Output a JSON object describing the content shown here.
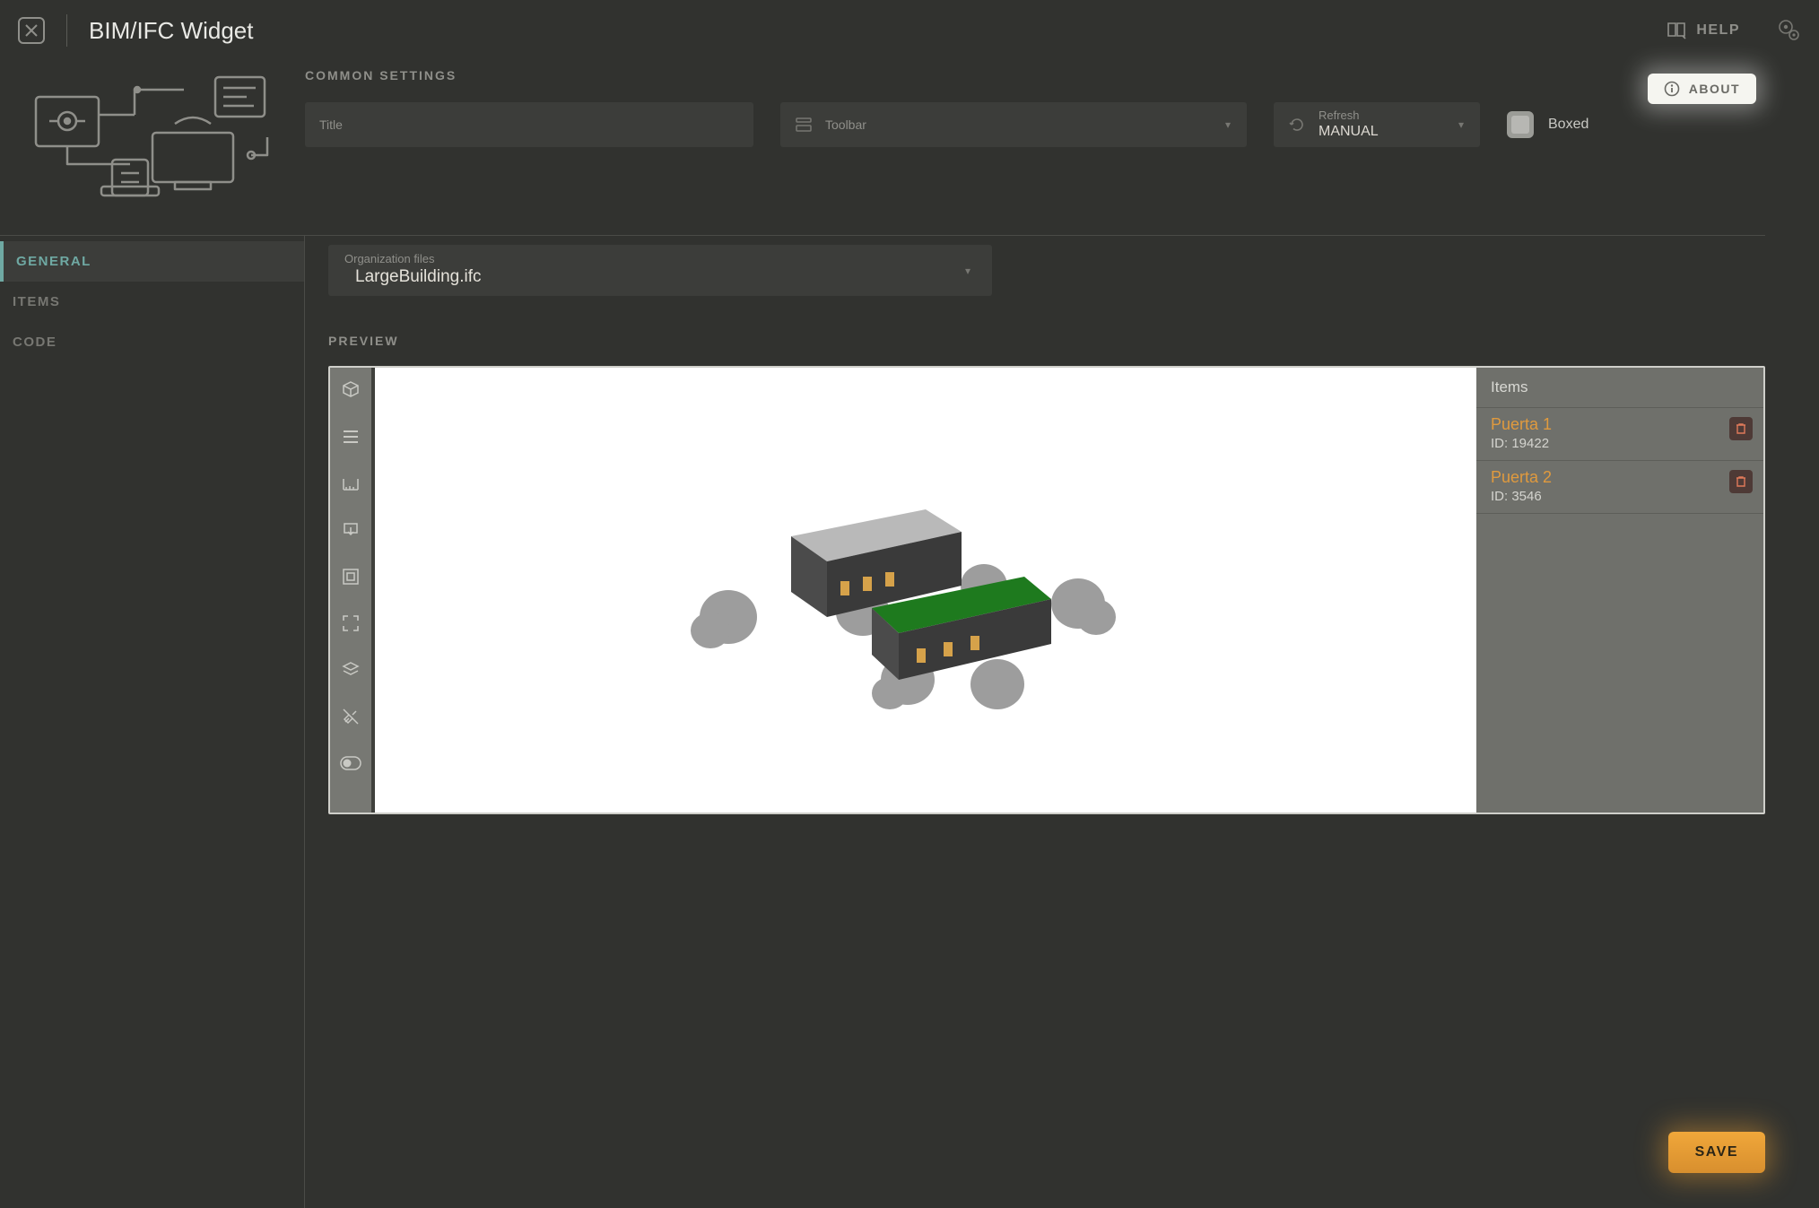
{
  "header": {
    "title": "BIM/IFC Widget",
    "help_label": "HELP"
  },
  "about_label": "ABOUT",
  "common": {
    "heading": "COMMON SETTINGS",
    "title_label": "Title",
    "toolbar_label": "Toolbar",
    "refresh_label": "Refresh",
    "refresh_value": "MANUAL",
    "boxed_label": "Boxed"
  },
  "sidebar": {
    "tabs": [
      {
        "label": "GENERAL"
      },
      {
        "label": "ITEMS"
      },
      {
        "label": "CODE"
      }
    ]
  },
  "main": {
    "org_files_label": "Organization files",
    "org_files_value": "LargeBuilding.ifc",
    "preview_label": "PREVIEW",
    "items_panel": {
      "heading": "Items",
      "entries": [
        {
          "name": "Puerta 1",
          "id_prefix": "ID:",
          "id": "19422"
        },
        {
          "name": "Puerta 2",
          "id_prefix": "ID:",
          "id": "3546"
        }
      ]
    }
  },
  "save_label": "SAVE"
}
